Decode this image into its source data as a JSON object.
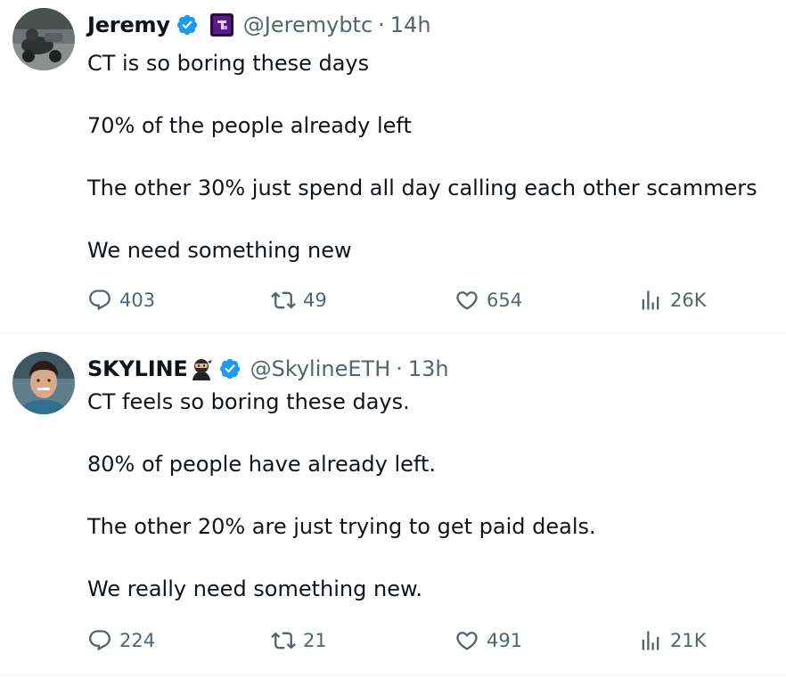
{
  "colors": {
    "text_primary": "#0f1419",
    "text_secondary": "#536471",
    "verified_blue": "#1d9bf0",
    "divider": "#eff3f4"
  },
  "tweets": [
    {
      "name": "Jeremy",
      "verified_icon": "verified-badge-icon",
      "badge_icon": "purple-affiliate-badge-icon",
      "handle": "@Jeremybtc",
      "separator": "·",
      "time": "14h",
      "paragraphs": [
        "CT is so boring these days",
        "70% of the people already left",
        "The other 30% just spend all day calling each other scammers",
        "We need something new"
      ],
      "replies": "403",
      "retweets": "49",
      "likes": "654",
      "views": "26K"
    },
    {
      "name": "SKYLINE",
      "name_emoji": "ninja-emoji",
      "verified_icon": "verified-badge-icon",
      "handle": "@SkylineETH",
      "separator": "·",
      "time": "13h",
      "paragraphs": [
        "CT feels so boring these days.",
        "80% of people have already left.",
        "The other 20% are just trying to get paid deals.",
        "We really need something new."
      ],
      "replies": "224",
      "retweets": "21",
      "likes": "491",
      "views": "21K"
    }
  ]
}
